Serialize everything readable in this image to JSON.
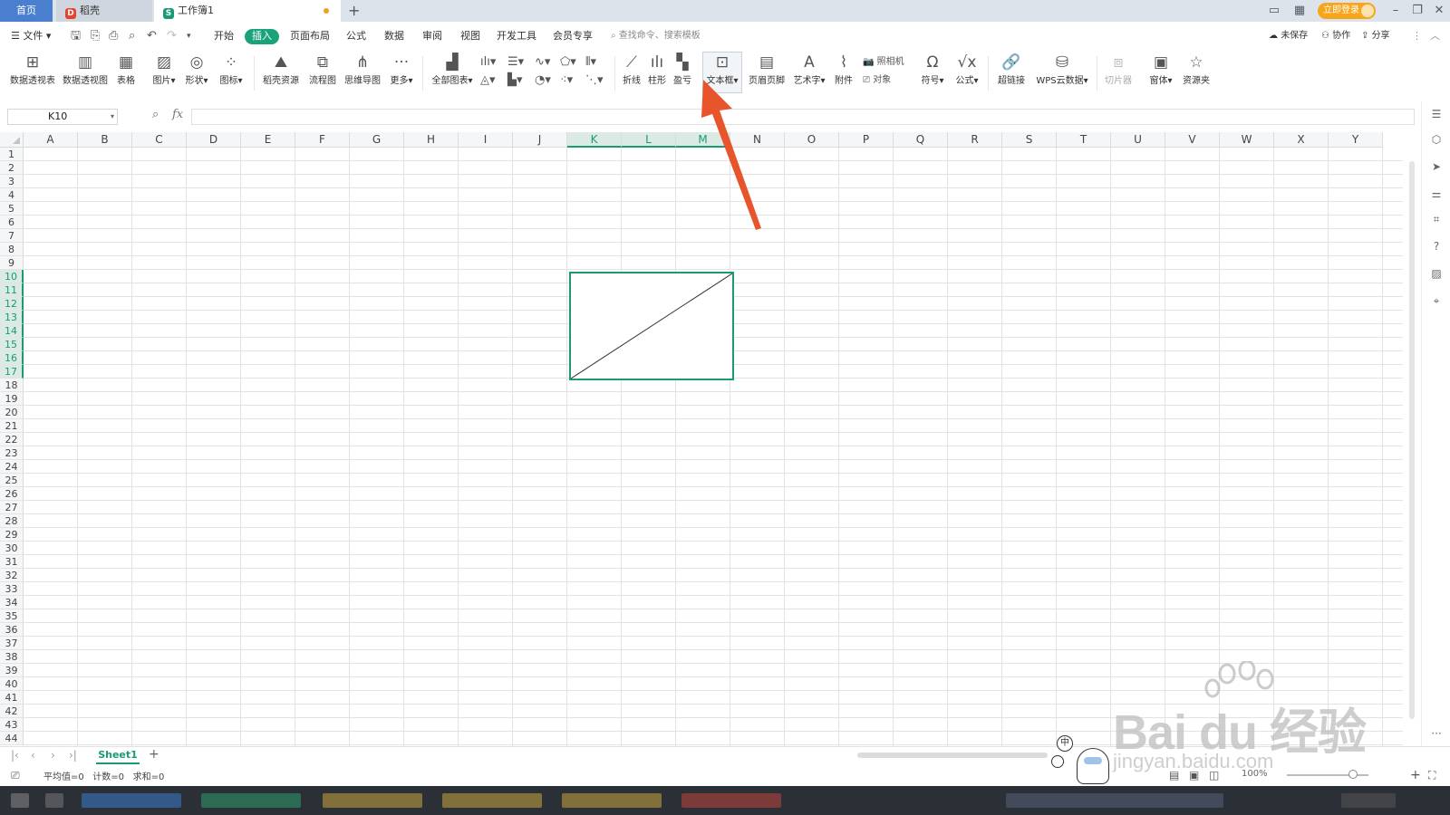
{
  "titlebar": {
    "home_tab": "首页",
    "daoke_tab": "稻壳",
    "workbook_tab": "工作簿1",
    "login_btn": "立即登录"
  },
  "menubar": {
    "file": "文件",
    "items": [
      "开始",
      "插入",
      "页面布局",
      "公式",
      "数据",
      "审阅",
      "视图",
      "开发工具",
      "会员专享"
    ],
    "search_placeholder": "查找命令、搜索模板",
    "unsaved": "未保存",
    "collab": "协作",
    "share": "分享"
  },
  "ribbon": {
    "pivot_table": "数据透视表",
    "pivot_chart": "数据透视图",
    "table": "表格",
    "picture": "图片",
    "shape": "形状",
    "icon": "图标",
    "daoke_res": "稻壳资源",
    "flowchart": "流程图",
    "mindmap": "思维导图",
    "more": "更多",
    "all_charts": "全部图表",
    "line": "折线",
    "column": "柱形",
    "winloss": "盈亏",
    "textbox": "文本框",
    "header_footer": "页眉页脚",
    "wordart": "艺术字",
    "attachment": "附件",
    "camera": "照相机",
    "object": "对象",
    "symbol": "符号",
    "formula": "公式",
    "hyperlink": "超链接",
    "wps_cloud": "WPS云数据",
    "slicer": "切片器",
    "window": "窗体",
    "resource": "资源夹"
  },
  "formulabar": {
    "namebox": "K10",
    "fx": "fx"
  },
  "columns": [
    "A",
    "B",
    "C",
    "D",
    "E",
    "F",
    "G",
    "H",
    "I",
    "J",
    "K",
    "L",
    "M",
    "N",
    "O",
    "P",
    "Q",
    "R",
    "S",
    "T",
    "U",
    "V",
    "W",
    "X",
    "Y"
  ],
  "selected_columns": [
    "K",
    "L",
    "M"
  ],
  "row_count": 44,
  "selected_rows": [
    10,
    11,
    12,
    13,
    14,
    15,
    16,
    17
  ],
  "sheet": {
    "tab": "Sheet1"
  },
  "statusbar": {
    "avg": "平均值=0",
    "count": "计数=0",
    "sum": "求和=0",
    "zoom": "100%"
  },
  "watermark": {
    "text": "Bai du 经验",
    "url": "jingyan.baidu.com",
    "ime": "中"
  },
  "colors": {
    "accent": "#1a9b76",
    "arrow": "#e8542c",
    "insert_tab": "#1aa37a",
    "login": "#f7a51c"
  }
}
